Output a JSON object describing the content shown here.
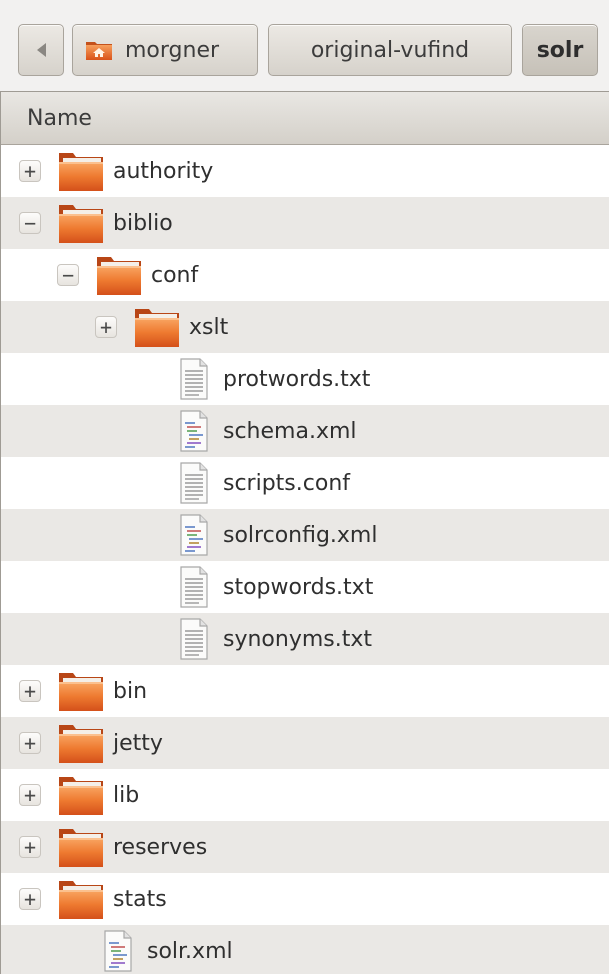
{
  "pathbar": {
    "back_glyph": "◂",
    "crumbs": [
      {
        "label": "morgner",
        "icon": "home-folder-icon"
      },
      {
        "label": "original-vufind"
      },
      {
        "label": "solr"
      }
    ]
  },
  "list": {
    "column_header": "Name",
    "rows": [
      {
        "name": "authority",
        "type": "folder",
        "depth": 0,
        "expander": "+",
        "alt": false
      },
      {
        "name": "biblio",
        "type": "folder",
        "depth": 0,
        "expander": "−",
        "alt": true
      },
      {
        "name": "conf",
        "type": "folder",
        "depth": 1,
        "expander": "−",
        "alt": false
      },
      {
        "name": "xslt",
        "type": "folder",
        "depth": 2,
        "expander": "+",
        "alt": true
      },
      {
        "name": "protwords.txt",
        "type": "text",
        "depth": 3,
        "expander": "",
        "alt": false
      },
      {
        "name": "schema.xml",
        "type": "xml",
        "depth": 3,
        "expander": "",
        "alt": true
      },
      {
        "name": "scripts.conf",
        "type": "text",
        "depth": 3,
        "expander": "",
        "alt": false
      },
      {
        "name": "solrconfig.xml",
        "type": "xml",
        "depth": 3,
        "expander": "",
        "alt": true
      },
      {
        "name": "stopwords.txt",
        "type": "text",
        "depth": 3,
        "expander": "",
        "alt": false
      },
      {
        "name": "synonyms.txt",
        "type": "text",
        "depth": 3,
        "expander": "",
        "alt": true
      },
      {
        "name": "bin",
        "type": "folder",
        "depth": 0,
        "expander": "+",
        "alt": false
      },
      {
        "name": "jetty",
        "type": "folder",
        "depth": 0,
        "expander": "+",
        "alt": true
      },
      {
        "name": "lib",
        "type": "folder",
        "depth": 0,
        "expander": "+",
        "alt": false
      },
      {
        "name": "reserves",
        "type": "folder",
        "depth": 0,
        "expander": "+",
        "alt": true
      },
      {
        "name": "stats",
        "type": "folder",
        "depth": 0,
        "expander": "+",
        "alt": false
      },
      {
        "name": "solr.xml",
        "type": "xml",
        "depth": 1,
        "expander": "",
        "alt": true
      }
    ]
  },
  "colors": {
    "folder_orange": "#e8691e",
    "row_alt": "#eae8e5",
    "header_bg": "#dcd8d2"
  }
}
